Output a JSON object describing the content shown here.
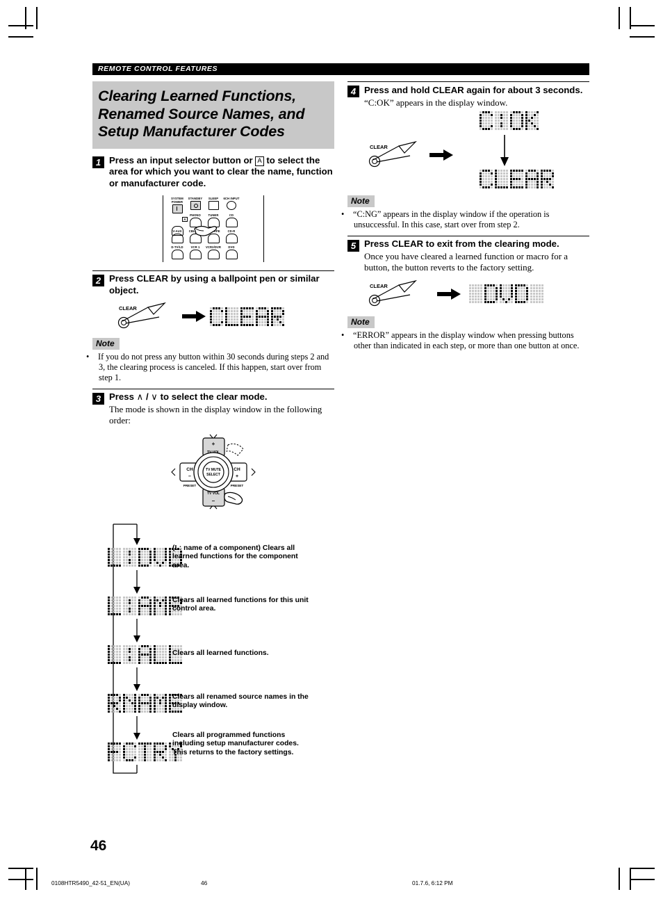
{
  "header": {
    "running_head": "REMOTE CONTROL FEATURES"
  },
  "title": {
    "line1": "Clearing Learned Functions,",
    "line2": "Renamed Source Names, and",
    "line3": "Setup Manufacturer Codes"
  },
  "steps": {
    "s1": {
      "number": "1",
      "head_a": "Press an input selector button or",
      "head_key": "A",
      "head_b": "to select the area for which you want to clear the name, function or manufacturer code."
    },
    "s2": {
      "number": "2",
      "head": "Press CLEAR by using a ballpoint pen or similar object.",
      "pen_label": "CLEAR",
      "display": "CLEAR"
    },
    "s3": {
      "number": "3",
      "head_a": "Press",
      "head_up": "∧",
      "head_sep": "/",
      "head_down": "∨",
      "head_b": "to select the clear mode.",
      "body": "The mode is shown in the display window in the following order:"
    },
    "s4": {
      "number": "4",
      "head": "Press and hold CLEAR again for about 3 seconds.",
      "body": "“C:OK” appears in the display window.",
      "pen_label": "CLEAR",
      "display_first": "C:OK",
      "display_second": "CLEAR"
    },
    "s5": {
      "number": "5",
      "head": "Press CLEAR to exit from the clearing mode.",
      "body": "Once you have cleared a learned function or macro for a button, the button reverts to the factory setting.",
      "pen_label": "CLEAR",
      "display": " DVD "
    }
  },
  "notes": {
    "note_label": "Note",
    "n1": "If you do not press any button within 30 seconds during steps 2 and 3, the clearing process is canceled. If this happen, start over from step 1.",
    "n2": "“C:NG” appears in the display window if the operation is unsuccessful. In this case, start over from step 2.",
    "n3": "“ERROR” appears in the display window when pressing buttons other than indicated in each step, or more than one button at once."
  },
  "remote": {
    "row1": [
      "SYSTEM\nPOWER",
      "STANDBY",
      "SLEEP",
      "6CH INPUT"
    ],
    "row2": [
      "A",
      "PHONO",
      "TUNER",
      "CD"
    ],
    "row3": [
      "V-AUX",
      "CBL/SAT",
      "MD/TAPE",
      "CD-R"
    ],
    "row4": [
      "D-TV/LD",
      "VCR 1",
      "VCR2/DVR",
      "DVD"
    ]
  },
  "navpad": {
    "up_plus": "+",
    "up_label": "TV VOL",
    "down_label": "TV VOL",
    "down_minus": "–",
    "left_ch": "CH",
    "left_minus": "–",
    "left_preset": "PRESET",
    "right_ch": "CH",
    "right_plus": "+",
    "right_preset": "PRESET",
    "center_line1": "TV MUTE",
    "center_line2": "SELECT"
  },
  "flow": {
    "items": [
      {
        "display": "L:DVD",
        "desc": "(L: name of a component) Clears all learned functions for the component area."
      },
      {
        "display": "L:AMP",
        "desc": "Clears all learned functions for this unit control area."
      },
      {
        "display": "L:ALL",
        "desc": "Clears all learned functions."
      },
      {
        "display": "RNAME",
        "desc": "Clears all renamed source names in the display window."
      },
      {
        "display": "FCTRY",
        "desc": "Clears all programmed functions including setup manufacturer codes. This returns to the factory settings."
      }
    ]
  },
  "page_number": "46",
  "footer": {
    "file": "0108HTR5490_42-51_EN(UA)",
    "page": "46",
    "date": "01.7.6, 6:12 PM"
  }
}
